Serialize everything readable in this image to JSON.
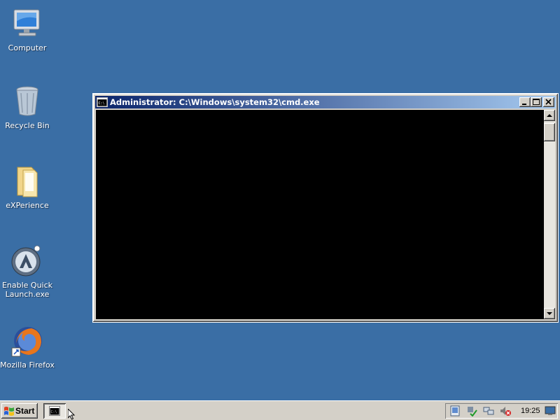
{
  "desktop": {
    "background_color": "#3a6ea5",
    "icons": [
      {
        "label": "Computer",
        "icon": "computer-icon"
      },
      {
        "label": "Recycle Bin",
        "icon": "recycle-bin-icon"
      },
      {
        "label": "eXPerience",
        "icon": "folder-icon"
      },
      {
        "label": "Enable Quick Launch.exe",
        "icon": "quick-launch-app-icon"
      },
      {
        "label": "Mozilla Firefox",
        "icon": "firefox-icon"
      }
    ]
  },
  "cmd_window": {
    "title": "Administrator: C:\\Windows\\system32\\cmd.exe",
    "title_icon": "cmd-prompt-icon",
    "console_text": "",
    "caption_buttons": [
      "minimize-icon",
      "maximize-icon",
      "close-icon"
    ]
  },
  "taskbar": {
    "start_label": "Start",
    "task_buttons": [
      {
        "icon": "cmd-prompt-icon"
      }
    ],
    "tray_icons": [
      "drive-icon",
      "safely-remove-hardware-icon",
      "network-icon",
      "volume-muted-icon"
    ],
    "clock": "19:25",
    "trailing_icon": "desktop-icon"
  }
}
